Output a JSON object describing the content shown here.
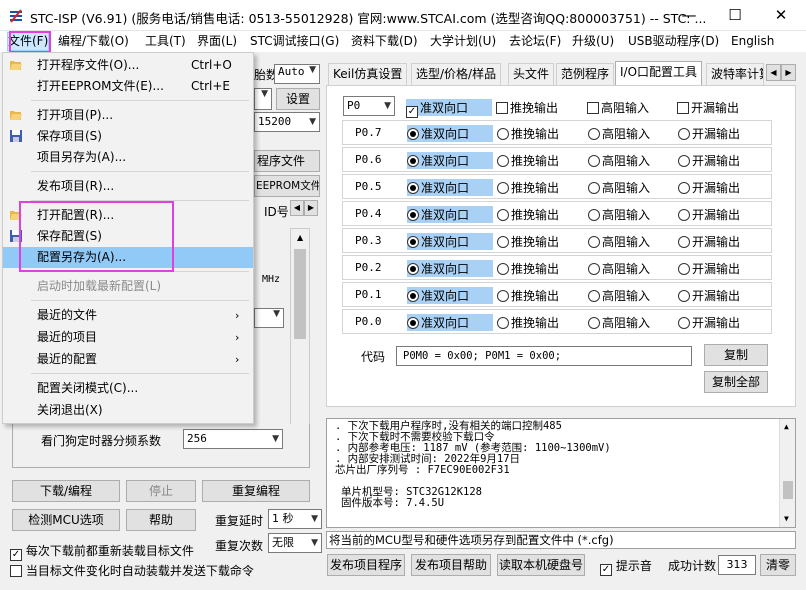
{
  "window": {
    "title": "STC-ISP (V6.91) (服务电话/销售电话: 0513-55012928) 官网:www.STCAI.com (选型咨询QQ:800003751) -- STC: ..."
  },
  "menu": {
    "items": [
      "文件(F)",
      "编程/下载(O)",
      "工具(T)",
      "界面(L)",
      "STC调试接口(G)",
      "资料下载(D)",
      "大学计划(U)",
      "去论坛(F)",
      "升级(U)",
      "USB驱动程序(D)",
      "English"
    ]
  },
  "file_menu": {
    "open_program": "打开程序文件(O)...",
    "open_program_sc": "Ctrl+O",
    "open_eeprom": "打开EEPROM文件(E)...",
    "open_eeprom_sc": "Ctrl+E",
    "open_project": "打开项目(P)...",
    "save_project": "保存项目(S)",
    "save_project_as": "项目另存为(A)...",
    "publish_project": "发布项目(R)...",
    "open_config": "打开配置(R)...",
    "save_config": "保存配置(S)",
    "save_config_as": "配置另存为(A)...",
    "load_latest": "启动时加载最新配置(L)",
    "recent_files": "最近的文件",
    "recent_projects": "最近的项目",
    "recent_configs": "最近的配置",
    "close_mode": "配置关闭模式(C)...",
    "exit": "关闭退出(X)"
  },
  "left": {
    "partial_arr": "胎数",
    "auto": "Auto",
    "settings": "设置",
    "baud": "15200",
    "program_file": "程序文件",
    "eeprom_file": "EEPROM文件",
    "id_label": "ID号",
    "mhz": "MHz",
    "watchdog_label": "看门狗定时器分频系数",
    "watchdog_value": "256",
    "download": "下载/编程",
    "stop": "停止",
    "reprogram": "重复编程",
    "check_mcu": "检测MCU选项",
    "help": "帮助",
    "repeat_delay_label": "重复延时",
    "repeat_delay": "1 秒",
    "repeat_count_label": "重复次数",
    "repeat_count": "无限",
    "reload_each": "每次下载前都重新装载目标文件",
    "auto_send": "当目标文件变化时自动装载并发送下载命令"
  },
  "tabs": [
    "Keil仿真设置",
    "选型/价格/样品",
    "头文件",
    "范例程序",
    "I/O口配置工具",
    "波特率计算"
  ],
  "io": {
    "port": "P0",
    "opts": [
      "准双向口",
      "推挽输出",
      "高阻输入",
      "开漏输出"
    ],
    "pins": [
      "P0.7",
      "P0.6",
      "P0.5",
      "P0.4",
      "P0.3",
      "P0.2",
      "P0.1",
      "P0.0"
    ],
    "code_label": "代码",
    "code_value": "P0M0 = 0x00;  P0M1 = 0x00;",
    "copy": "复制",
    "copy_all": "复制全部"
  },
  "log": {
    "lines": [
      ". 下次下载用户程序时,没有相关的端口控制485",
      ". 下次下载时不需要校验下载口令",
      ". 内部参考电压: 1187 mV (参考范围: 1100~1300mV)",
      ". 内部安排测试时间: 2022年9月17日",
      "芯片出厂序列号 : F7EC90E002F31",
      "",
      "单片机型号: STC32G12K128",
      "固件版本号: 7.4.5U"
    ]
  },
  "status": {
    "text": "将当前的MCU型号和硬件选项另存到配置文件中 (*.cfg)"
  },
  "bottom": {
    "publish": "发布项目程序",
    "publish_help": "发布项目帮助",
    "read_disk": "读取本机硬盘号",
    "beep": "提示音",
    "success_label": "成功计数",
    "success_count": "313",
    "clear": "清零"
  }
}
